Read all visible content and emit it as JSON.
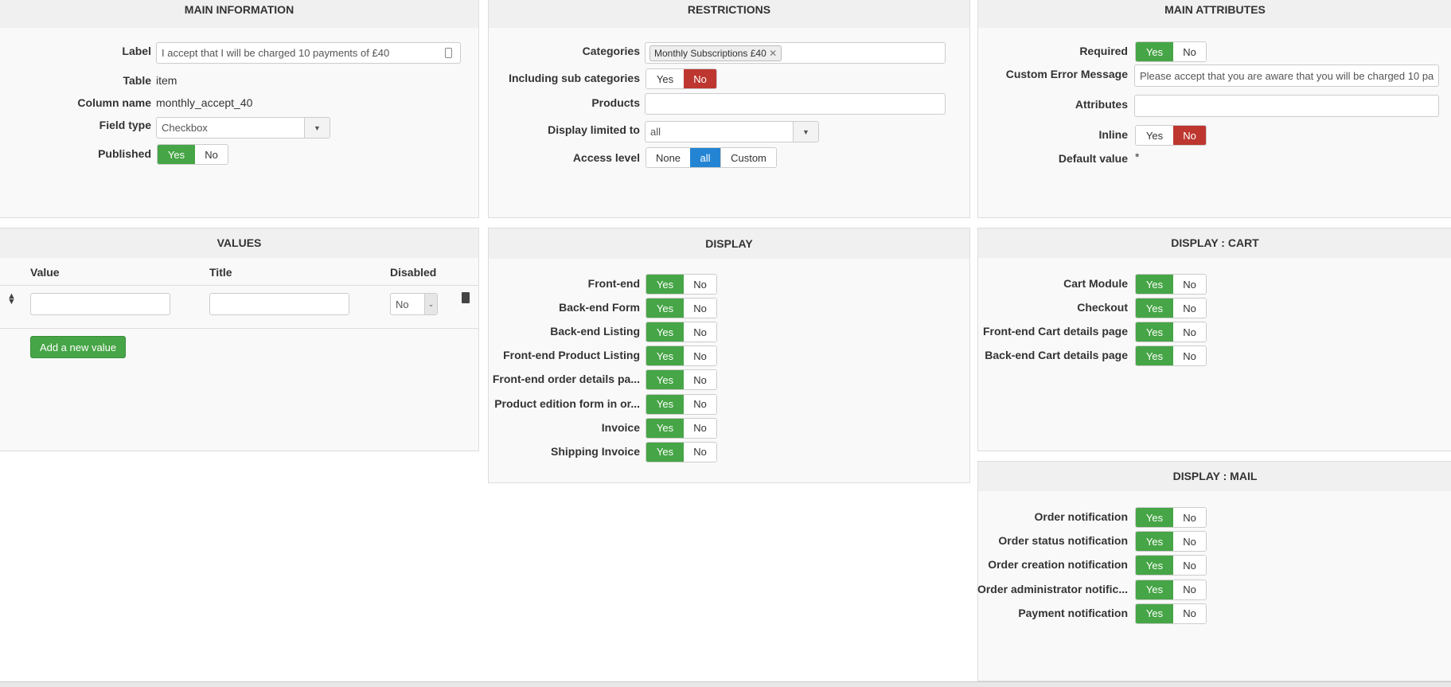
{
  "main_information": {
    "title": "MAIN INFORMATION",
    "label_label": "Label",
    "label_value": "I accept that I will be charged 10 payments of £40",
    "table_label": "Table",
    "table_value": "item",
    "column_label": "Column name",
    "column_value": "monthly_accept_40",
    "field_type_label": "Field type",
    "field_type_value": "Checkbox",
    "published_label": "Published",
    "published": {
      "yes": "Yes",
      "no": "No",
      "value": "Yes"
    }
  },
  "restrictions": {
    "title": "RESTRICTIONS",
    "categories_label": "Categories",
    "categories_tag": "Monthly Subscriptions £40",
    "sub_label": "Including sub categories",
    "sub": {
      "yes": "Yes",
      "no": "No",
      "value": "No"
    },
    "products_label": "Products",
    "products_value": "",
    "display_limited_label": "Display limited to",
    "display_limited_value": "all",
    "access_label": "Access level",
    "access_options": [
      "None",
      "all",
      "Custom"
    ],
    "access_value": "all"
  },
  "main_attributes": {
    "title": "MAIN ATTRIBUTES",
    "required_label": "Required",
    "required": {
      "yes": "Yes",
      "no": "No",
      "value": "Yes"
    },
    "error_label": "Custom Error Message",
    "error_value": "Please accept that you are aware that you will be charged 10 pa",
    "attributes_label": "Attributes",
    "attributes_value": "",
    "inline_label": "Inline",
    "inline": {
      "yes": "Yes",
      "no": "No",
      "value": "No"
    },
    "default_label": "Default value",
    "default_marker": "*"
  },
  "values": {
    "title": "VALUES",
    "columns": [
      "Value",
      "Title",
      "Disabled"
    ],
    "row": {
      "value": "",
      "title": "",
      "disabled": "No"
    },
    "add_button": "Add a new value"
  },
  "display": {
    "title": "DISPLAY",
    "items": [
      {
        "label": "Front-end",
        "value": "Yes"
      },
      {
        "label": "Back-end Form",
        "value": "Yes"
      },
      {
        "label": "Back-end Listing",
        "value": "Yes"
      },
      {
        "label": "Front-end Product Listing",
        "value": "Yes"
      },
      {
        "label": "Front-end order details pa...",
        "value": "Yes"
      },
      {
        "label": "Product edition form in or...",
        "value": "Yes"
      },
      {
        "label": "Invoice",
        "value": "Yes"
      },
      {
        "label": "Shipping Invoice",
        "value": "Yes"
      }
    ]
  },
  "display_cart": {
    "title": "DISPLAY : CART",
    "items": [
      {
        "label": "Cart Module",
        "value": "Yes"
      },
      {
        "label": "Checkout",
        "value": "Yes"
      },
      {
        "label": "Front-end Cart details page",
        "value": "Yes"
      },
      {
        "label": "Back-end Cart details page",
        "value": "Yes"
      }
    ]
  },
  "display_mail": {
    "title": "DISPLAY : MAIL",
    "items": [
      {
        "label": "Order notification",
        "value": "Yes"
      },
      {
        "label": "Order status notification",
        "value": "Yes"
      },
      {
        "label": "Order creation notification",
        "value": "Yes"
      },
      {
        "label": "Order administrator notific...",
        "value": "Yes"
      },
      {
        "label": "Payment notification",
        "value": "Yes"
      }
    ]
  },
  "toggle_labels": {
    "yes": "Yes",
    "no": "No"
  },
  "colors": {
    "yes_active": "#46a546",
    "no_active": "#bd362f",
    "selected": "#2384d3"
  }
}
